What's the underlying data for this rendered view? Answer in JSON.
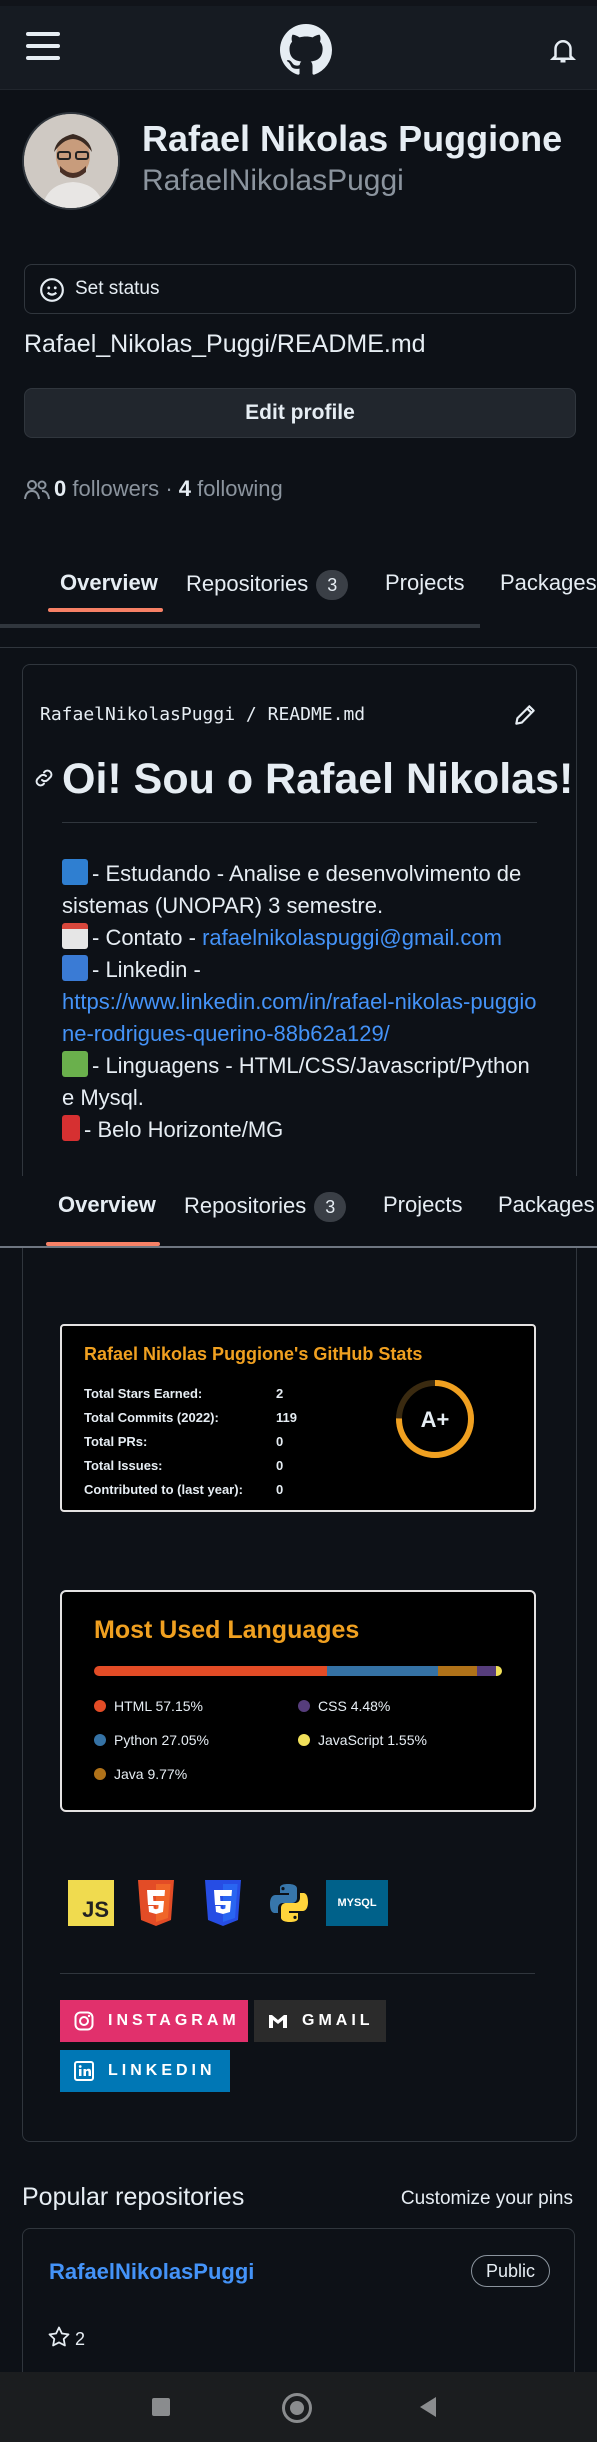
{
  "app": {
    "name": "GitHub",
    "accent": "#f78166"
  },
  "header": {
    "menu_icon": "hamburger-icon",
    "logo_icon": "github-logo-icon",
    "notifications_icon": "bell-icon"
  },
  "profile": {
    "full_name": "Rafael Nikolas Puggione",
    "username": "RafaelNikolasPuggi",
    "status_label": "Set status",
    "readme_path": "Rafael_Nikolas_Puggi/README.md",
    "edit_profile_label": "Edit profile",
    "followers_count": "0",
    "followers_label": "followers",
    "separator": "·",
    "following_count": "4",
    "following_label": "following"
  },
  "tabs": [
    {
      "label": "Overview",
      "active": true
    },
    {
      "label": "Repositories",
      "count": "3"
    },
    {
      "label": "Projects"
    },
    {
      "label": "Packages"
    }
  ],
  "readme": {
    "owner": "RafaelNikolasPuggi",
    "slash": "/",
    "file": "README.md",
    "heading": "Oi! Sou o Rafael Nikolas!",
    "line1": "- Estudando - Analise e desenvolvimento de sistemas (UNOPAR) 3 semestre.",
    "line2_prefix": "- Contato -",
    "line2_email": "rafaelnikolaspuggi@gmail.com",
    "line3": "- Linkedin -",
    "line3_url": "https://www.linkedin.com/in/rafael-nikolas-puggione-rodrigues-querino-88b62a129/",
    "line4": "- Linguagens - HTML/CSS/Javascript/Python e Mysql.",
    "line5": "- Belo Horizonte/MG"
  },
  "stats": {
    "title": "Rafael Nikolas Puggione's GitHub Stats",
    "rows": [
      {
        "label": "Total Stars Earned:",
        "value": "2"
      },
      {
        "label": "Total Commits (2022):",
        "value": "119"
      },
      {
        "label": "Total PRs:",
        "value": "0"
      },
      {
        "label": "Total Issues:",
        "value": "0"
      },
      {
        "label": "Contributed to (last year):",
        "value": "0"
      }
    ],
    "grade": "A+",
    "ring_color": "#f0a020"
  },
  "languages": {
    "title": "Most Used Languages",
    "items": [
      {
        "name": "HTML",
        "percent": "57.15%",
        "color": "#e34c26"
      },
      {
        "name": "Python",
        "percent": "27.05%",
        "color": "#3572a5"
      },
      {
        "name": "Java",
        "percent": "9.77%",
        "color": "#b07219"
      },
      {
        "name": "CSS",
        "percent": "4.48%",
        "color": "#563d7c"
      },
      {
        "name": "JavaScript",
        "percent": "1.55%",
        "color": "#f1e05a"
      }
    ]
  },
  "tech_badges": {
    "js": "JS",
    "mysql": "MYSQL"
  },
  "social": {
    "instagram": "INSTAGRAM",
    "gmail": "GMAIL",
    "linkedin": "LINKEDIN"
  },
  "popular": {
    "title": "Popular repositories",
    "customize_label": "Customize your pins",
    "repo_name": "RafaelNikolasPuggi",
    "visibility": "Public",
    "stars": "2"
  }
}
